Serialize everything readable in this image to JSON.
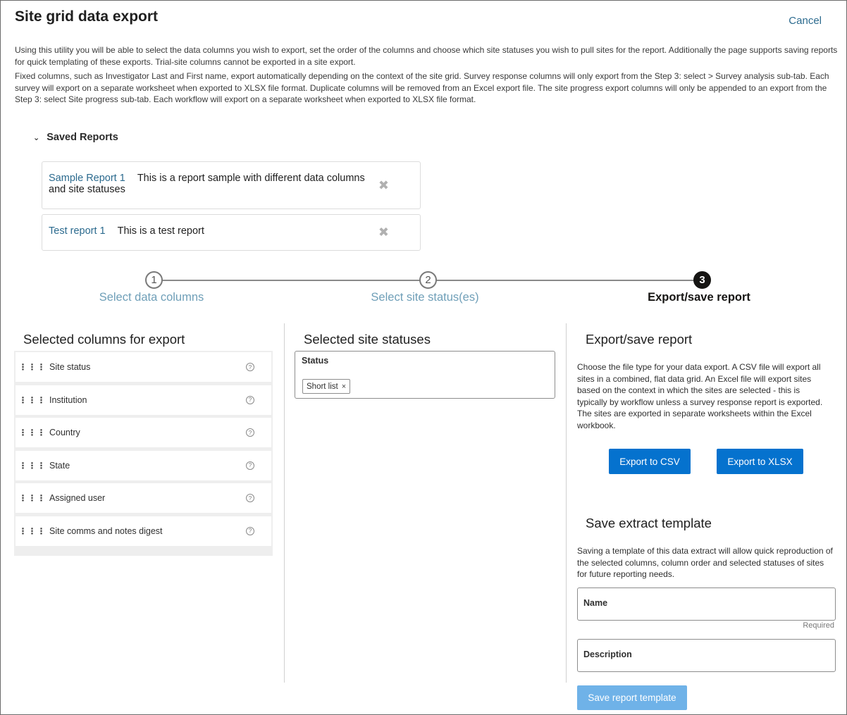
{
  "page": {
    "title": "Site grid data export",
    "cancel_label": "Cancel",
    "intro_p1": "Using this utility you will be able to select the data columns you wish to export, set the order of the columns and choose which site statuses you wish to pull sites for the report. Additionally the page supports saving reports for quick templating of these exports. Trial-site columns cannot be exported in a site export.",
    "intro_p2": "Fixed columns, such as Investigator Last and First name, export automatically depending on the context of the site grid. Survey response columns will only export from the Step 3: select > Survey analysis sub-tab. Each survey will export on a separate worksheet when exported to XLSX file format. Duplicate columns will be removed from an Excel export file. The site progress export columns will only be appended to an export from the Step 3: select Site progress sub-tab. Each workflow will export on a separate worksheet when exported to XLSX file format."
  },
  "saved_reports": {
    "header": "Saved Reports",
    "items": [
      {
        "name": "Sample Report 1",
        "description": "This is a report sample with different data columns and site statuses"
      },
      {
        "name": "Test report 1",
        "description": "This is a test report"
      }
    ]
  },
  "stepper": {
    "steps": [
      {
        "number": "1",
        "label": "Select data columns"
      },
      {
        "number": "2",
        "label": "Select site status(es)"
      },
      {
        "number": "3",
        "label": "Export/save report"
      }
    ],
    "active_step": 3
  },
  "columns_panel": {
    "title": "Selected columns for export",
    "items": [
      "Site status",
      "Institution",
      "Country",
      "State",
      "Assigned user",
      "Site comms and notes digest"
    ]
  },
  "statuses_panel": {
    "title": "Selected site statuses",
    "field_label": "Status",
    "chips": [
      "Short list"
    ]
  },
  "export_panel": {
    "title": "Export/save report",
    "description": "Choose the file type for your data export. A CSV file will export all sites in a combined, flat data grid. An Excel file will export sites based on the context in which the sites are selected - this is typically by workflow unless a survey response report is exported. The sites are exported in separate worksheets within the Excel workbook.",
    "csv_button": "Export to CSV",
    "xlsx_button": "Export to XLSX",
    "save_title": "Save extract template",
    "save_description": "Saving a template of this data extract will allow quick reproduction of the selected columns, column order and selected statuses of sites for future reporting needs.",
    "name_label": "Name",
    "required_label": "Required",
    "description_label": "Description",
    "save_button": "Save report template"
  },
  "icons": {
    "chevron": "chevron-down-icon",
    "remove": "close-icon",
    "drag": "drag-handle-icon",
    "help": "help-icon"
  },
  "colors": {
    "primary": "#0572ce",
    "link": "#2b6a8e",
    "step_inactive": "#6f9fb8",
    "disabled_button": "#6fb2e8"
  }
}
